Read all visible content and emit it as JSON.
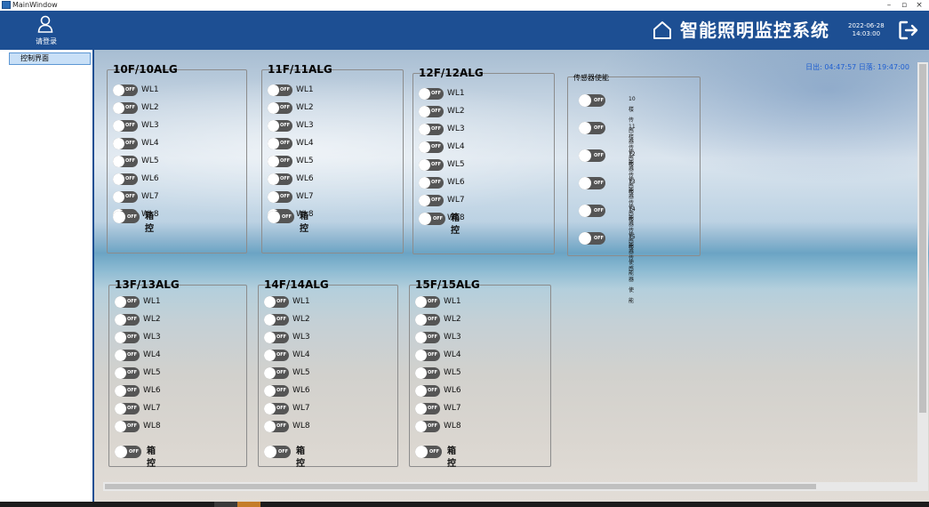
{
  "window": {
    "title": "MainWindow"
  },
  "sidebar": {
    "login_label": "请登录",
    "nav_items": [
      {
        "label": "控制界面"
      }
    ]
  },
  "header": {
    "title": "智能照明监控系统",
    "date": "2022-06-28",
    "time": "14:03:00"
  },
  "sun": {
    "text": "日出: 04:47:57  日落: 19:47:00"
  },
  "toggle_state_label": "OFF",
  "floors": [
    {
      "title": "10F/10ALG",
      "lines": [
        "WL1",
        "WL2",
        "WL3",
        "WL4",
        "WL5",
        "WL6",
        "WL7",
        "WL8"
      ],
      "box_label": "箱控"
    },
    {
      "title": "11F/11ALG",
      "lines": [
        "WL1",
        "WL2",
        "WL3",
        "WL4",
        "WL5",
        "WL6",
        "WL7",
        "WL8"
      ],
      "box_label": "箱控"
    },
    {
      "title": "12F/12ALG",
      "lines": [
        "WL1",
        "WL2",
        "WL3",
        "WL4",
        "WL5",
        "WL6",
        "WL7",
        "WL8"
      ],
      "box_label": "箱控"
    },
    {
      "title": "13F/13ALG",
      "lines": [
        "WL1",
        "WL2",
        "WL3",
        "WL4",
        "WL5",
        "WL6",
        "WL7",
        "WL8"
      ],
      "box_label": "箱控"
    },
    {
      "title": "14F/14ALG",
      "lines": [
        "WL1",
        "WL2",
        "WL3",
        "WL4",
        "WL5",
        "WL6",
        "WL7",
        "WL8"
      ],
      "box_label": "箱控"
    },
    {
      "title": "15F/15ALG",
      "lines": [
        "WL1",
        "WL2",
        "WL3",
        "WL4",
        "WL5",
        "WL6",
        "WL7",
        "WL8"
      ],
      "box_label": "箱控"
    }
  ],
  "sensors": {
    "title": "传感器使能",
    "items": [
      "10楼传感器使能",
      "11楼传感器使能",
      "12楼传感器使能",
      "13楼传感器使能",
      "14楼传感器使能",
      "15楼传感器使能"
    ]
  },
  "colors": {
    "header_bg": "#1d4f93",
    "toggle_off": "#555555",
    "sun_text": "#1f5fd0"
  }
}
